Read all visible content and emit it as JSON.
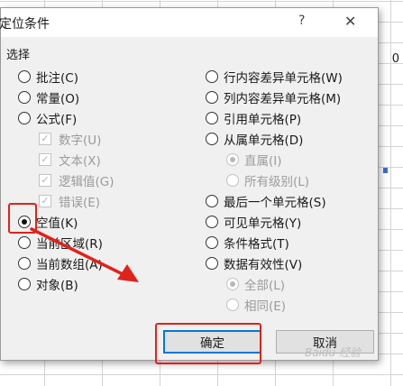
{
  "dialog": {
    "title": "定位条件",
    "help": "?",
    "close": "✕",
    "section_label": "选择"
  },
  "left_options": [
    {
      "label": "批注(C)",
      "type": "radio",
      "checked": false,
      "enabled": true
    },
    {
      "label": "常量(O)",
      "type": "radio",
      "checked": false,
      "enabled": true
    },
    {
      "label": "公式(F)",
      "type": "radio",
      "checked": false,
      "enabled": true
    },
    {
      "label": "数字(U)",
      "type": "checkbox",
      "checked": true,
      "enabled": false
    },
    {
      "label": "文本(X)",
      "type": "checkbox",
      "checked": true,
      "enabled": false
    },
    {
      "label": "逻辑值(G)",
      "type": "checkbox",
      "checked": true,
      "enabled": false
    },
    {
      "label": "错误(E)",
      "type": "checkbox",
      "checked": true,
      "enabled": false
    },
    {
      "label": "空值(K)",
      "type": "radio",
      "checked": true,
      "enabled": true
    },
    {
      "label": "当前区域(R)",
      "type": "radio",
      "checked": false,
      "enabled": true
    },
    {
      "label": "当前数组(A)",
      "type": "radio",
      "checked": false,
      "enabled": true
    },
    {
      "label": "对象(B)",
      "type": "radio",
      "checked": false,
      "enabled": true
    }
  ],
  "right_options": [
    {
      "label": "行内容差异单元格(W)",
      "type": "radio",
      "checked": false,
      "enabled": true
    },
    {
      "label": "列内容差异单元格(M)",
      "type": "radio",
      "checked": false,
      "enabled": true
    },
    {
      "label": "引用单元格(P)",
      "type": "radio",
      "checked": false,
      "enabled": true
    },
    {
      "label": "从属单元格(D)",
      "type": "radio",
      "checked": false,
      "enabled": true
    },
    {
      "label": "直属(I)",
      "type": "radio",
      "checked": true,
      "enabled": false
    },
    {
      "label": "所有级别(L)",
      "type": "radio",
      "checked": false,
      "enabled": false
    },
    {
      "label": "最后一个单元格(S)",
      "type": "radio",
      "checked": false,
      "enabled": true
    },
    {
      "label": "可见单元格(Y)",
      "type": "radio",
      "checked": false,
      "enabled": true
    },
    {
      "label": "条件格式(T)",
      "type": "radio",
      "checked": false,
      "enabled": true
    },
    {
      "label": "数据有效性(V)",
      "type": "radio",
      "checked": false,
      "enabled": true
    },
    {
      "label": "全部(L)",
      "type": "radio",
      "checked": true,
      "enabled": false
    },
    {
      "label": "相同(E)",
      "type": "radio",
      "checked": false,
      "enabled": false
    }
  ],
  "buttons": {
    "ok": "确定",
    "cancel": "取消"
  },
  "sheet": {
    "cell_text": "0"
  },
  "annotation_color": "#e0221c",
  "watermark": "Baidu 经验"
}
